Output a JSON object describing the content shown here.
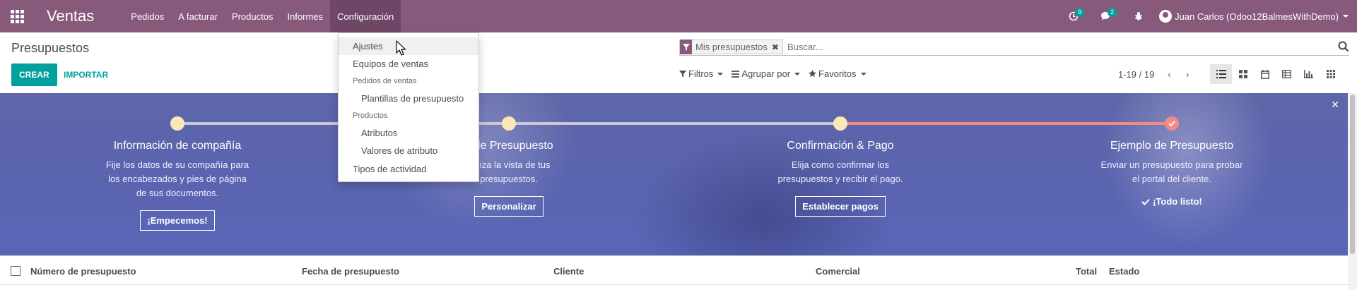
{
  "navbar": {
    "brand": "Ventas",
    "menu": [
      "Pedidos",
      "A facturar",
      "Productos",
      "Informes",
      "Configuración"
    ],
    "activity_badge": "9",
    "messages_badge": "2",
    "user": "Juan Carlos (Odoo12BalmesWithDemo)",
    "color": "#875a7b"
  },
  "control_panel": {
    "title": "Presupuestos",
    "create": "CREAR",
    "import": "IMPORTAR",
    "search": {
      "facet": "Mis presupuestos",
      "placeholder": "Buscar..."
    },
    "filters": [
      "Filtros",
      "Agrupar por",
      "Favoritos"
    ],
    "pager": "1-19 / 19",
    "views": [
      "list-view-icon",
      "kanban-view-icon",
      "calendar-view-icon",
      "pivot-view-icon",
      "graph-view-icon",
      "activity-view-icon"
    ]
  },
  "dropdown": {
    "items": {
      "ajustes": "Ajustes",
      "equipos": "Equipos de ventas",
      "header_pedidos": "Pedidos de ventas",
      "plantillas": "Plantillas de presupuesto",
      "header_productos": "Productos",
      "atributos": "Atributos",
      "valores": "Valores de atributo",
      "tipos": "Tipos de actividad"
    }
  },
  "banner": {
    "steps": [
      {
        "title": "Información de compañía",
        "desc1": "Fije los datos de su compañía para",
        "desc2": "los encabezados y pies de página",
        "desc3": "de sus documentos.",
        "button": "¡Empecemos!"
      },
      {
        "title": "o de Presupuesto",
        "desc1": "naliza la vista de tus",
        "desc2": "presupuestos.",
        "desc3": "",
        "button": "Personalizar"
      },
      {
        "title": "Confirmación & Pago",
        "desc1": "Elija como confirmar los",
        "desc2": "presupuestos y recibir el pago.",
        "desc3": "",
        "button": "Establecer pagos"
      },
      {
        "title": "Ejemplo de Presupuesto",
        "desc1": "Enviar un presupuesto para probar",
        "desc2": "el portal del cliente.",
        "desc3": "",
        "done": "¡Todo listo!"
      }
    ]
  },
  "table": {
    "columns": [
      "Número de presupuesto",
      "Fecha de presupuesto",
      "Cliente",
      "Comercial",
      "Total",
      "Estado"
    ]
  }
}
